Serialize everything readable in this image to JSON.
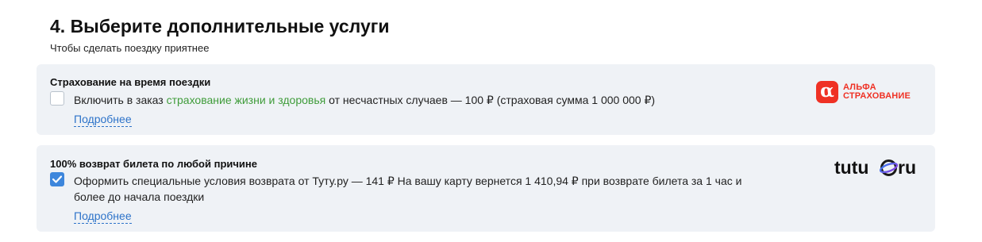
{
  "section": {
    "title": "4. Выберите дополнительные услуги",
    "subtitle": "Чтобы сделать поездку приятнее"
  },
  "insurance": {
    "title": "Страхование на время поездки",
    "checked": false,
    "desc_prefix": "Включить в заказ ",
    "desc_link": "страхование жизни и здоровья",
    "desc_suffix": " от несчастных случаев — 100 ₽ (страховая сумма 1 000 000 ₽)",
    "more_label": "Подробнее",
    "logo": {
      "mark": "α",
      "line1": "АЛЬФА",
      "line2": "СТРАХОВАНИЕ",
      "color": "#ef3124"
    }
  },
  "refund": {
    "title": "100% возврат билета по любой причине",
    "checked": true,
    "desc": "Оформить специальные условия возврата от Туту.ру — 141 ₽ На вашу карту вернется 1 410,94 ₽ при возврате билета за 1 час и более до начала поездки",
    "more_label": "Подробнее",
    "logo": {
      "part1": "tutu",
      "part2": "ru",
      "icon": "globe-icon"
    }
  },
  "colors": {
    "card_bg": "#eff2f6",
    "checkbox_checked": "#3d86dc",
    "link": "#2d73c9",
    "green_link": "#3f9c3a"
  }
}
